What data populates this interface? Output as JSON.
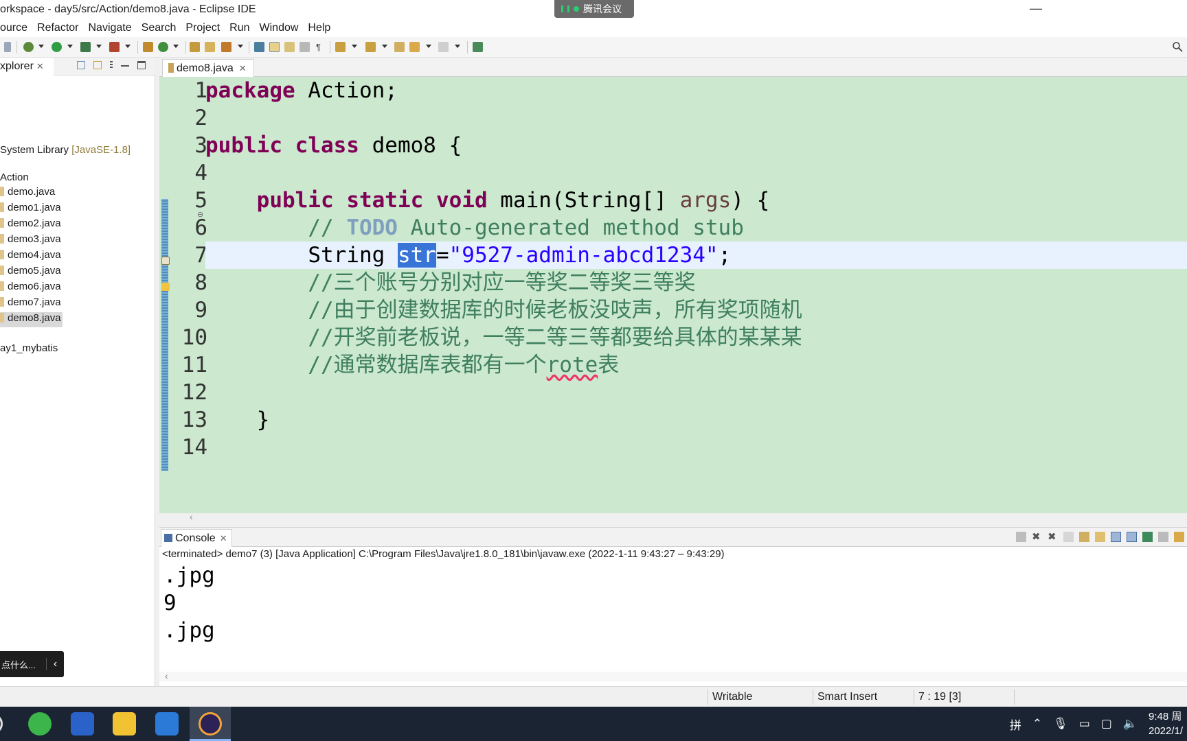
{
  "window": {
    "title": "orkspace - day5/src/Action/demo8.java - Eclipse IDE",
    "meeting_badge": "腾讯会议"
  },
  "menu": [
    "ource",
    "Refactor",
    "Navigate",
    "Search",
    "Project",
    "Run",
    "Window",
    "Help"
  ],
  "explorer": {
    "tab_label": "xplorer",
    "close": "✕",
    "library": {
      "name": "System Library ",
      "decoration": "[JavaSE-1.8]"
    },
    "package": "Action",
    "files": [
      "demo.java",
      "demo1.java",
      "demo2.java",
      "demo3.java",
      "demo4.java",
      "demo5.java",
      "demo6.java",
      "demo7.java",
      "demo8.java"
    ],
    "selected_file": "demo8.java",
    "project": "ay1_mybatis",
    "ask_box": {
      "text": "点什么...",
      "button": "‹"
    }
  },
  "editor": {
    "tab_label": "demo8.java",
    "close": "✕",
    "line_numbers": [
      "1",
      "2",
      "3",
      "4",
      "5",
      "6",
      "7",
      "8",
      "9",
      "10",
      "11",
      "12",
      "13",
      "14"
    ],
    "code": {
      "l1_kw": "package",
      "l1_rest": " Action;",
      "l3_kw1": "public",
      "l3_kw2": "class",
      "l3_rest": " demo8 {",
      "l5_indent": "    ",
      "l5_kw1": "public",
      "l5_kw2": "static",
      "l5_kw3": "void",
      "l5_mid": " main(String[] ",
      "l5_param": "args",
      "l5_end": ") {",
      "l6_indent": "        ",
      "l6_prefix": "// ",
      "l6_todo": "TODO",
      "l6_rest": " Auto-generated method stub",
      "l7_indent": "        ",
      "l7_type": "String ",
      "l7_var": "str",
      "l7_eq": "=",
      "l7_str": "\"9527-admin-abcd1234\"",
      "l7_end": ";",
      "l8": "        //三个账号分别对应一等奖二等奖三等奖",
      "l9": "        //由于创建数据库的时候老板没吱声，所有奖项随机",
      "l10": "        //开奖前老板说，一等二等三等都要给具体的某某某",
      "l11_prefix": "        //通常数据库表都有一个",
      "l11_wavy": "rote",
      "l11_suffix": "表",
      "l13": "    }"
    }
  },
  "console": {
    "tab_label": "Console",
    "close": "✕",
    "status": "<terminated> demo7 (3) [Java Application] C:\\Program Files\\Java\\jre1.8.0_181\\bin\\javaw.exe  (2022-1-11 9:43:27 – 9:43:29)",
    "output": [
      ".jpg",
      "9",
      ".jpg"
    ]
  },
  "statusbar": {
    "writable": "Writable",
    "insert_mode": "Smart Insert",
    "position": "7 : 19 [3]"
  },
  "taskbar": {
    "ime": "拼",
    "time": "9:48 周",
    "date": "2022/1/"
  },
  "colors": {
    "editor_bg": "#cce8cf",
    "keyword": "#7f0055",
    "comment": "#3f7f5f",
    "string": "#2a00ff",
    "selection": "#3875d7",
    "taskbar": "#1b2433"
  }
}
